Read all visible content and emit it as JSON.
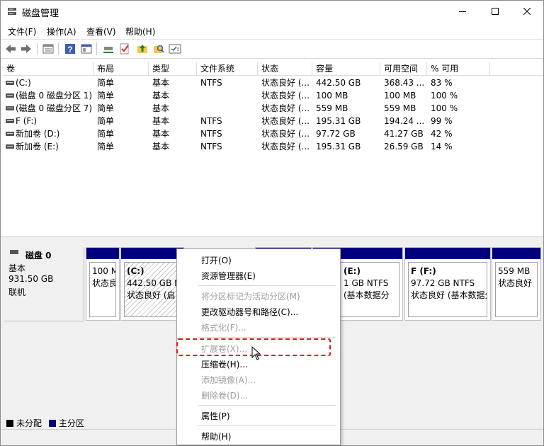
{
  "window": {
    "title": "磁盘管理",
    "minimize_icon": "minimize-icon",
    "maximize_icon": "maximize-icon",
    "close_icon": "close-icon"
  },
  "menu": [
    "文件(F)",
    "操作(A)",
    "查看(V)",
    "帮助(H)"
  ],
  "toolbar": [
    "back-arrow-icon",
    "forward-arrow-icon",
    "list-view-icon",
    "help-icon",
    "properties-icon",
    "connect-icon",
    "check-icon",
    "up-folder-icon",
    "search-folder-icon",
    "settings-panel-icon"
  ],
  "volume_list": {
    "headers": [
      "卷",
      "布局",
      "类型",
      "文件系统",
      "状态",
      "容量",
      "可用空间",
      "% 可用"
    ],
    "rows": [
      [
        "(C:)",
        "简单",
        "基本",
        "NTFS",
        "状态良好 (...",
        "442.50 GB",
        "368.43 ...",
        "83 %"
      ],
      [
        "(磁盘 0 磁盘分区 1)",
        "简单",
        "基本",
        "",
        "状态良好 (...",
        "100 MB",
        "100 MB",
        "100 %"
      ],
      [
        "(磁盘 0 磁盘分区 7)",
        "简单",
        "基本",
        "",
        "状态良好 (...",
        "559 MB",
        "559 MB",
        "100 %"
      ],
      [
        "F (F:)",
        "简单",
        "基本",
        "NTFS",
        "状态良好 (...",
        "195.31 GB",
        "194.24 ...",
        "99 %"
      ],
      [
        "新加卷 (D:)",
        "简单",
        "基本",
        "NTFS",
        "状态良好 (...",
        "97.72 GB",
        "41.27 GB",
        "42 %"
      ],
      [
        "新加卷 (E:)",
        "简单",
        "基本",
        "NTFS",
        "状态良好 (...",
        "195.31 GB",
        "26.59 GB",
        "14 %"
      ]
    ]
  },
  "disk": {
    "name": "磁盘 0",
    "type": "基本",
    "size": "931.50 GB",
    "status": "联机"
  },
  "partitions": [
    {
      "line1": "",
      "line2": "100 M",
      "line3": "状态良"
    },
    {
      "line1": "(C:)",
      "line2": "442.50 GB N",
      "line3": "状态良好 (启"
    },
    {
      "line1": "",
      "line2": "",
      "line3": ""
    },
    {
      "line1": "(E:)",
      "line2": "1 GB NTFS",
      "line3": "(基本数据分"
    },
    {
      "line1": "F  (F:)",
      "line2": "97.72 GB NTFS",
      "line3": "状态良好 (基本数据分"
    },
    {
      "line1": "",
      "line2": "559 MB",
      "line3": "状态良好"
    }
  ],
  "legend": {
    "unallocated": "未分配",
    "primary": "主分区",
    "unallocated_color": "#000000",
    "primary_color": "#00007f"
  },
  "context_menu": [
    {
      "label": "打开(O)",
      "disabled": false
    },
    {
      "label": "资源管理器(E)",
      "disabled": false
    },
    {
      "label": "将分区标记为活动分区(M)",
      "disabled": true
    },
    {
      "label": "更改驱动器号和路径(C)...",
      "disabled": false
    },
    {
      "label": "格式化(F)...",
      "disabled": true
    },
    {
      "label": "扩展卷(X)...",
      "disabled": true
    },
    {
      "label": "压缩卷(H)...",
      "disabled": false
    },
    {
      "label": "添加镜像(A)...",
      "disabled": true
    },
    {
      "label": "删除卷(D)...",
      "disabled": true
    },
    {
      "label": "属性(P)",
      "disabled": false
    },
    {
      "label": "帮助(H)",
      "disabled": false
    }
  ],
  "colors": {
    "partition_bar": "#00007f",
    "highlight_dash": "#e81010"
  }
}
